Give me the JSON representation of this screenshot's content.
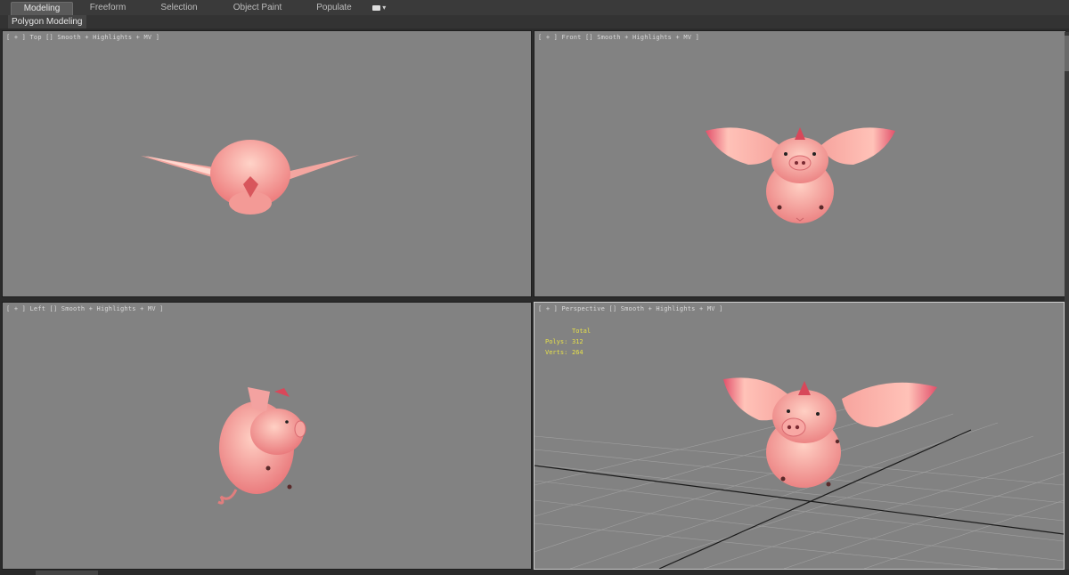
{
  "ribbon": {
    "tabs": [
      "Modeling",
      "Freeform",
      "Selection",
      "Object Paint",
      "Populate"
    ],
    "active_tab": "Modeling",
    "options_icon": "dropdown-options-icon"
  },
  "subpanel": {
    "label": "Polygon Modeling"
  },
  "viewports": {
    "top": {
      "label": "[ + ] Top [] Smooth + Highlights + MV ]"
    },
    "front": {
      "label": "[ + ] Front [] Smooth + Highlights + MV ]"
    },
    "left": {
      "label": "[ + ] Left [] Smooth + Highlights + MV ]"
    },
    "perspective": {
      "label": "[ + ] Perspective [] Smooth + Highlights + MV ]",
      "stats": {
        "header": "Total",
        "polys_label": "Polys:",
        "polys_value": "312",
        "verts_label": "Verts:",
        "verts_value": "264"
      }
    }
  },
  "colors": {
    "viewport_bg": "#828282",
    "pig_body": "#f08a88",
    "pig_light": "#ffd0c4",
    "pig_dark": "#c8505a",
    "stats_text": "#e6e04a",
    "grid": "#a8a8a8"
  }
}
